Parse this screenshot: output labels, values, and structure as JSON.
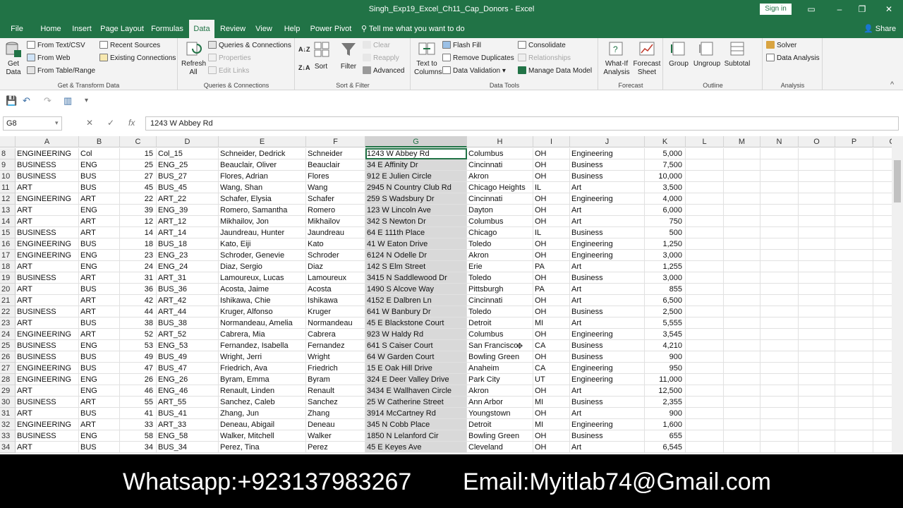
{
  "window": {
    "title": "Singh_Exp19_Excel_Ch11_Cap_Donors  -  Excel",
    "signin": "Sign in",
    "buttons": [
      "▭",
      "–",
      "❐",
      "✕"
    ]
  },
  "tabs": [
    "File",
    "Home",
    "Insert",
    "Page Layout",
    "Formulas",
    "Data",
    "Review",
    "View",
    "Help",
    "Power Pivot"
  ],
  "active_tab": "Data",
  "tellme": "Tell me what you want to do",
  "share": "Share",
  "ribbon": {
    "get_transform": {
      "label": "Get & Transform Data",
      "get_data": "Get Data",
      "items": [
        "From Text/CSV",
        "From Web",
        "From Table/Range",
        "Recent Sources",
        "Existing Connections"
      ]
    },
    "queries": {
      "label": "Queries & Connections",
      "refresh": "Refresh All",
      "items": [
        "Queries & Connections",
        "Properties",
        "Edit Links"
      ]
    },
    "sort_filter": {
      "label": "Sort & Filter",
      "sort": "Sort",
      "filter": "Filter",
      "items": [
        "Clear",
        "Reapply",
        "Advanced"
      ]
    },
    "data_tools": {
      "label": "Data Tools",
      "text_to_columns": "Text to Columns",
      "items": [
        "Flash Fill",
        "Remove Duplicates",
        "Data Validation",
        "Consolidate",
        "Relationships",
        "Manage Data Model"
      ]
    },
    "forecast": {
      "label": "Forecast",
      "what_if": "What-If Analysis",
      "forecast_sheet": "Forecast Sheet"
    },
    "outline": {
      "label": "Outline",
      "items": [
        "Group",
        "Ungroup",
        "Subtotal"
      ]
    },
    "analysis": {
      "label": "Analysis",
      "items": [
        "Solver",
        "Data Analysis"
      ]
    }
  },
  "formula_bar": {
    "name_box": "G8",
    "content": "1243 W Abbey Rd"
  },
  "columns": [
    "A",
    "B",
    "C",
    "D",
    "E",
    "F",
    "G",
    "H",
    "I",
    "J",
    "K",
    "L",
    "M",
    "N",
    "O",
    "P",
    "C"
  ],
  "selected_column": "G",
  "rows": [
    {
      "n": "8",
      "c": [
        "ENGINEERING",
        "Col",
        "15",
        "Col_15",
        "Schneider, Dedrick",
        "Schneider",
        "1243 W Abbey Rd",
        "Columbus",
        "OH",
        "Engineering",
        "5,000"
      ]
    },
    {
      "n": "9",
      "c": [
        "BUSINESS",
        "ENG",
        "25",
        "ENG_25",
        "Beauclair, Oliver",
        "Beauclair",
        "34 E Affinity Dr",
        "Cincinnati",
        "OH",
        "Business",
        "7,500"
      ]
    },
    {
      "n": "10",
      "c": [
        "BUSINESS",
        "BUS",
        "27",
        "BUS_27",
        "Flores, Adrian",
        "Flores",
        "912 E Julien Circle",
        "Akron",
        "OH",
        "Business",
        "10,000"
      ]
    },
    {
      "n": "11",
      "c": [
        "ART",
        "BUS",
        "45",
        "BUS_45",
        "Wang, Shan",
        "Wang",
        "2945 N Country Club Rd",
        "Chicago Heights",
        "IL",
        "Art",
        "3,500"
      ]
    },
    {
      "n": "12",
      "c": [
        "ENGINEERING",
        "ART",
        "22",
        "ART_22",
        "Schafer, Elysia",
        "Schafer",
        "259 S Wadsbury Dr",
        "Cincinnati",
        "OH",
        "Engineering",
        "4,000"
      ]
    },
    {
      "n": "13",
      "c": [
        "ART",
        "ENG",
        "39",
        "ENG_39",
        "Romero, Samantha",
        "Romero",
        "123 W Lincoln Ave",
        "Dayton",
        "OH",
        "Art",
        "6,000"
      ]
    },
    {
      "n": "14",
      "c": [
        "ART",
        "ART",
        "12",
        "ART_12",
        "Mikhailov, Jon",
        "Mikhailov",
        "342 S Newton Dr",
        "Columbus",
        "OH",
        "Art",
        "750"
      ]
    },
    {
      "n": "15",
      "c": [
        "BUSINESS",
        "ART",
        "14",
        "ART_14",
        "Jaundreau, Hunter",
        "Jaundreau",
        "64 E 111th Place",
        "Chicago",
        "IL",
        "Business",
        "500"
      ]
    },
    {
      "n": "16",
      "c": [
        "ENGINEERING",
        "BUS",
        "18",
        "BUS_18",
        "Kato, Eiji",
        "Kato",
        "41 W Eaton Drive",
        "Toledo",
        "OH",
        "Engineering",
        "1,250"
      ]
    },
    {
      "n": "17",
      "c": [
        "ENGINEERING",
        "ENG",
        "23",
        "ENG_23",
        "Schroder, Genevie",
        "Schroder",
        "6124 N Odelle Dr",
        "Akron",
        "OH",
        "Engineering",
        "3,000"
      ]
    },
    {
      "n": "18",
      "c": [
        "ART",
        "ENG",
        "24",
        "ENG_24",
        "Diaz, Sergio",
        "Diaz",
        "142 S Elm Street",
        "Erie",
        "PA",
        "Art",
        "1,255"
      ]
    },
    {
      "n": "19",
      "c": [
        "BUSINESS",
        "ART",
        "31",
        "ART_31",
        "Lamoureux, Lucas",
        "Lamoureux",
        "3415 N Saddlewood Dr",
        "Toledo",
        "OH",
        "Business",
        "3,000"
      ]
    },
    {
      "n": "20",
      "c": [
        "ART",
        "BUS",
        "36",
        "BUS_36",
        "Acosta, Jaime",
        "Acosta",
        "1490 S Alcove Way",
        "Pittsburgh",
        "PA",
        "Art",
        "855"
      ]
    },
    {
      "n": "21",
      "c": [
        "ART",
        "ART",
        "42",
        "ART_42",
        "Ishikawa, Chie",
        "Ishikawa",
        "4152 E Dalbren Ln",
        "Cincinnati",
        "OH",
        "Art",
        "6,500"
      ]
    },
    {
      "n": "22",
      "c": [
        "BUSINESS",
        "ART",
        "44",
        "ART_44",
        "Kruger, Alfonso",
        "Kruger",
        "641 W Banbury Dr",
        "Toledo",
        "OH",
        "Business",
        "2,500"
      ]
    },
    {
      "n": "23",
      "c": [
        "ART",
        "BUS",
        "38",
        "BUS_38",
        "Normandeau, Amelia",
        "Normandeau",
        "45 E Blackstone Court",
        "Detroit",
        "MI",
        "Art",
        "5,555"
      ]
    },
    {
      "n": "24",
      "c": [
        "ENGINEERING",
        "ART",
        "52",
        "ART_52",
        "Cabrera, Mia",
        "Cabrera",
        "923 W Haldy Rd",
        "Columbus",
        "OH",
        "Engineering",
        "3,545"
      ]
    },
    {
      "n": "25",
      "c": [
        "BUSINESS",
        "ENG",
        "53",
        "ENG_53",
        "Fernandez, Isabella",
        "Fernandez",
        "641 S Caiser Court",
        "San Francisco",
        "CA",
        "Business",
        "4,210"
      ]
    },
    {
      "n": "26",
      "c": [
        "BUSINESS",
        "BUS",
        "49",
        "BUS_49",
        "Wright, Jerri",
        "Wright",
        "64 W Garden Court",
        "Bowling Green",
        "OH",
        "Business",
        "900"
      ]
    },
    {
      "n": "27",
      "c": [
        "ENGINEERING",
        "BUS",
        "47",
        "BUS_47",
        "Friedrich, Ava",
        "Friedrich",
        "15 E Oak Hill Drive",
        "Anaheim",
        "CA",
        "Engineering",
        "950"
      ]
    },
    {
      "n": "28",
      "c": [
        "ENGINEERING",
        "ENG",
        "26",
        "ENG_26",
        "Byram, Emma",
        "Byram",
        "324 E Deer Valley Drive",
        "Park City",
        "UT",
        "Engineering",
        "11,000"
      ]
    },
    {
      "n": "29",
      "c": [
        "ART",
        "ENG",
        "46",
        "ENG_46",
        "Renault, Linden",
        "Renault",
        "3434 E Wallhaven Circle",
        "Akron",
        "OH",
        "Art",
        "12,500"
      ]
    },
    {
      "n": "30",
      "c": [
        "BUSINESS",
        "ART",
        "55",
        "ART_55",
        "Sanchez, Caleb",
        "Sanchez",
        "25 W Catherine Street",
        "Ann Arbor",
        "MI",
        "Business",
        "2,355"
      ]
    },
    {
      "n": "31",
      "c": [
        "ART",
        "BUS",
        "41",
        "BUS_41",
        "Zhang, Jun",
        "Zhang",
        "3914 McCartney Rd",
        "Youngstown",
        "OH",
        "Art",
        "900"
      ]
    },
    {
      "n": "32",
      "c": [
        "ENGINEERING",
        "ART",
        "33",
        "ART_33",
        "Deneau, Abigail",
        "Deneau",
        "345 N Cobb Place",
        "Detroit",
        "MI",
        "Engineering",
        "1,600"
      ]
    },
    {
      "n": "33",
      "c": [
        "BUSINESS",
        "ENG",
        "58",
        "ENG_58",
        "Walker, Mitchell",
        "Walker",
        "1850 N Lelanford Cir",
        "Bowling Green",
        "OH",
        "Business",
        "655"
      ]
    },
    {
      "n": "34",
      "c": [
        "ART",
        "BUS",
        "34",
        "BUS_34",
        "Perez, Tina",
        "Perez",
        "45 E Keyes Ave",
        "Cleveland",
        "OH",
        "Art",
        "6,545"
      ]
    }
  ],
  "banner": {
    "whatsapp": "Whatsapp:+923137983267",
    "email": "Email:Myitlab74@Gmail.com"
  },
  "colors": {
    "accent": "#217346",
    "ribbon_bg": "#f3f3f3",
    "selection": "#d9d9d9"
  }
}
